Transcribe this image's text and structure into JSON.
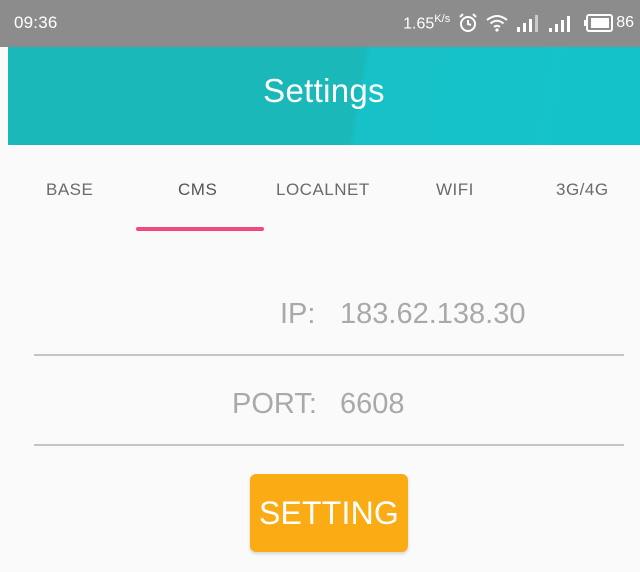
{
  "status_bar": {
    "time": "09:36",
    "speed": "1.65",
    "speed_unit": "K/s",
    "battery_level": "86",
    "icons": [
      "alarm-icon",
      "wifi-icon",
      "signal-icon",
      "signal-icon",
      "battery-icon"
    ]
  },
  "toolbar": {
    "title": "Settings",
    "color": "#1bb8b9"
  },
  "tabs": [
    {
      "label": "BASE",
      "active": false
    },
    {
      "label": "CMS",
      "active": true
    },
    {
      "label": "LOCALNET",
      "active": false
    },
    {
      "label": "WIFI",
      "active": false
    },
    {
      "label": "3G/4G",
      "active": false
    }
  ],
  "form": {
    "ip_label": "IP:",
    "ip_value": "183.62.138.30",
    "port_label": "PORT:",
    "port_value": "6608"
  },
  "button": {
    "label": "SETTING",
    "color": "#fbac14"
  },
  "colors": {
    "indicator": "#ef4a7d"
  }
}
